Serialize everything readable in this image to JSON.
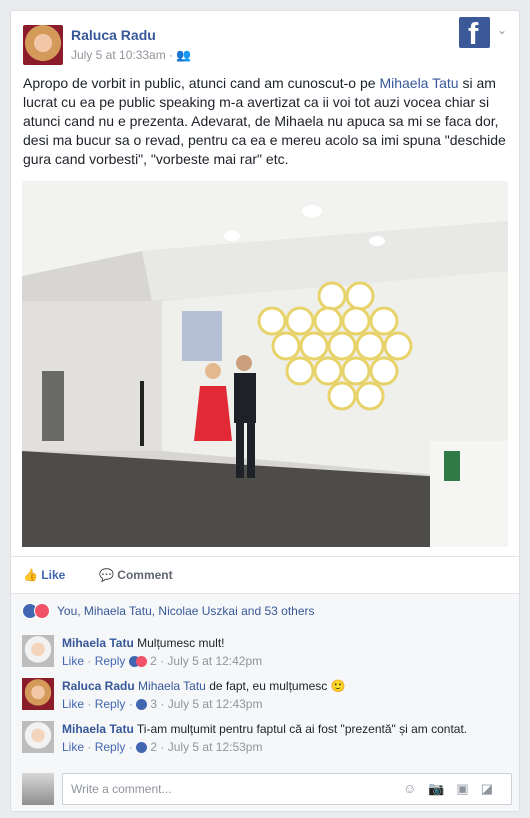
{
  "post": {
    "author": "Raluca Radu",
    "date": "July 5 at 10:33am",
    "text_1": "Apropo de vorbit in public, atunci cand am cunoscut-o pe ",
    "text_mention": "Mihaela Tatu",
    "text_2": " si am lucrat cu ea pe public speaking m-a avertizat ca ii voi tot auzi vocea chiar si atunci cand nu e prezenta. Adevarat, de Mihaela nu apuca sa mi se faca dor, desi ma bucur sa o revad, pentru ca ea e mereu acolo sa imi spuna \"deschide gura cand vorbesti\", \"vorbeste mai rar\" etc."
  },
  "actions": {
    "like": "Like",
    "comment": "Comment"
  },
  "reactions": {
    "summary": "You, Mihaela Tatu, Nicolae Uszkai and 53 others"
  },
  "comments": [
    {
      "author": "Mihaela Tatu",
      "mention": "",
      "text": "Mulțumesc mult!",
      "like": "Like",
      "reply": "Reply",
      "count": "2",
      "time": "July 5 at 12:42pm"
    },
    {
      "author": "Raluca Radu",
      "mention": "Mihaela Tatu",
      "text": " de fapt, eu mulțumesc 🙂",
      "like": "Like",
      "reply": "Reply",
      "count": "3",
      "time": "July 5 at 12:43pm"
    },
    {
      "author": "Mihaela Tatu",
      "mention": "",
      "text": "Ti-am mulțumit pentru faptul că ai fost \"prezentă\" și am contat.",
      "like": "Like",
      "reply": "Reply",
      "count": "2",
      "time": "July 5 at 12:53pm"
    }
  ],
  "composer": {
    "placeholder": "Write a comment..."
  },
  "colors": {
    "brand": "#3b5998",
    "link": "#365899",
    "love": "#f25268"
  },
  "icons": [
    "facebook-logo",
    "chevron-down-icon",
    "friends-icon",
    "like-icon",
    "comment-icon",
    "emoji-icon",
    "camera-icon",
    "gif-icon",
    "sticker-icon"
  ]
}
